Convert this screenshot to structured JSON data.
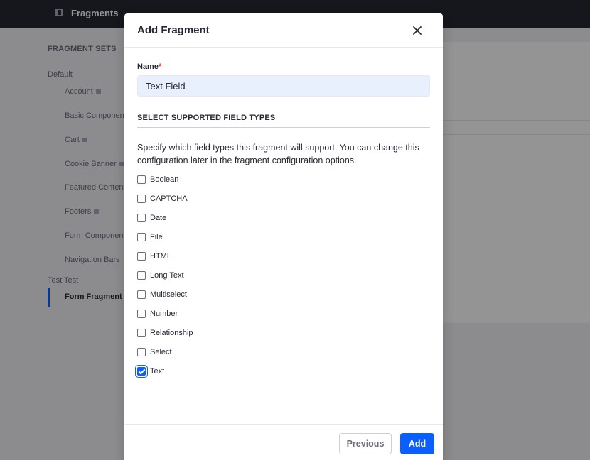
{
  "app": {
    "title": "Fragments"
  },
  "sidebar": {
    "title": "FRAGMENT SETS",
    "groups": [
      {
        "label": "Default",
        "items": [
          {
            "label": "Account",
            "locked": true
          },
          {
            "label": "Basic Components",
            "locked": false
          },
          {
            "label": "Cart",
            "locked": true
          },
          {
            "label": "Cookie Banner",
            "locked": true
          },
          {
            "label": "Featured Content",
            "locked": false
          },
          {
            "label": "Footers",
            "locked": true
          },
          {
            "label": "Form Components",
            "locked": false
          },
          {
            "label": "Navigation Bars",
            "locked": false
          }
        ]
      },
      {
        "label": "Test Test",
        "items": [
          {
            "label": "Form Fragment",
            "locked": false,
            "active": true
          }
        ]
      }
    ]
  },
  "modal": {
    "title": "Add Fragment",
    "name_label": "Name",
    "required_mark": "*",
    "name_value": "Text Field",
    "section_title": "SELECT SUPPORTED FIELD TYPES",
    "description": "Specify which field types this fragment will support. You can change this configuration later in the fragment configuration options.",
    "field_types": [
      {
        "label": "Boolean",
        "checked": false
      },
      {
        "label": "CAPTCHA",
        "checked": false
      },
      {
        "label": "Date",
        "checked": false
      },
      {
        "label": "File",
        "checked": false
      },
      {
        "label": "HTML",
        "checked": false
      },
      {
        "label": "Long Text",
        "checked": false
      },
      {
        "label": "Multiselect",
        "checked": false
      },
      {
        "label": "Number",
        "checked": false
      },
      {
        "label": "Relationship",
        "checked": false
      },
      {
        "label": "Select",
        "checked": false
      },
      {
        "label": "Text",
        "checked": true
      }
    ],
    "previous_label": "Previous",
    "add_label": "Add"
  },
  "colors": {
    "primary": "#0b5fff",
    "topbar": "#272833"
  }
}
